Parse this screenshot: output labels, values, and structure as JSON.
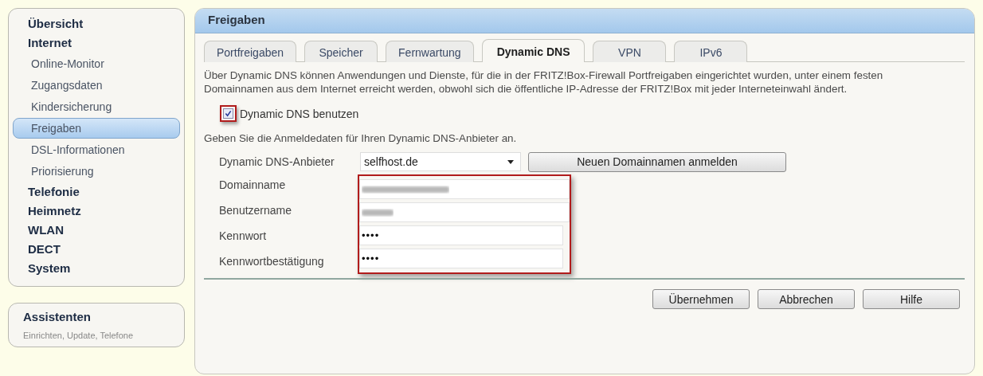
{
  "sidebar": {
    "items": [
      {
        "label": "Übersicht",
        "selected": false
      },
      {
        "label": "Internet",
        "selected": false,
        "children": [
          {
            "label": "Online-Monitor",
            "selected": false
          },
          {
            "label": "Zugangsdaten",
            "selected": false
          },
          {
            "label": "Kindersicherung",
            "selected": false
          },
          {
            "label": "Freigaben",
            "selected": true
          },
          {
            "label": "DSL-Informationen",
            "selected": false
          },
          {
            "label": "Priorisierung",
            "selected": false
          }
        ]
      },
      {
        "label": "Telefonie",
        "selected": false
      },
      {
        "label": "Heimnetz",
        "selected": false
      },
      {
        "label": "WLAN",
        "selected": false
      },
      {
        "label": "DECT",
        "selected": false
      },
      {
        "label": "System",
        "selected": false
      }
    ]
  },
  "assistant": {
    "title": "Assistenten",
    "subtitle": "Einrichten, Update, Telefone"
  },
  "panel": {
    "title": "Freigaben",
    "tabs": [
      {
        "label": "Portfreigaben",
        "selected": false
      },
      {
        "label": "Speicher",
        "selected": false
      },
      {
        "label": "Fernwartung",
        "selected": false
      },
      {
        "label": "Dynamic DNS",
        "selected": true
      },
      {
        "label": "VPN",
        "selected": false
      },
      {
        "label": "IPv6",
        "selected": false
      }
    ],
    "description": "Über Dynamic DNS können Anwendungen und Dienste, für die in der FRITZ!Box-Firewall Portfreigaben eingerichtet wurden, unter einem festen Domainnamen aus dem Internet erreicht werden, obwohl sich die öffentliche IP-Adresse der FRITZ!Box mit jeder Interneteinwahl ändert.",
    "use_checkbox": {
      "label": "Dynamic DNS benutzen",
      "checked": true,
      "highlighted": true
    },
    "hint": "Geben Sie die Anmeldedaten für Ihren Dynamic DNS-Anbieter an.",
    "provider": {
      "label": "Dynamic DNS-Anbieter",
      "value": "selfhost.de",
      "button": "Neuen Domainnamen anmelden"
    },
    "fields_highlighted": true,
    "fields": [
      {
        "label": "Domainname",
        "blurred": true
      },
      {
        "label": "Benutzername",
        "blurred": true
      },
      {
        "label": "Kennwort",
        "value": "••••",
        "blurred": false
      },
      {
        "label": "Kennwortbestätigung",
        "value": "••••",
        "blurred": false
      }
    ],
    "buttons": [
      "Übernehmen",
      "Abbrechen",
      "Hilfe"
    ]
  }
}
